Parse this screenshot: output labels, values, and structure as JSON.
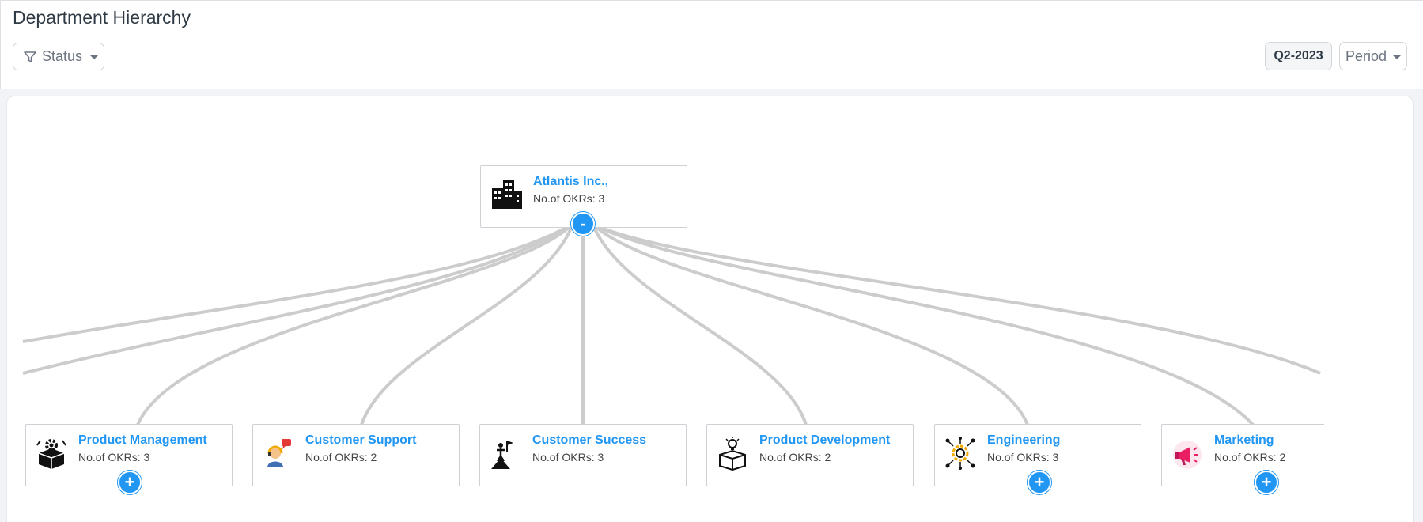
{
  "header": {
    "title": "Department Hierarchy",
    "filter_label": "Status",
    "period_value": "Q2-2023",
    "period_label": "Period"
  },
  "root": {
    "title": "Atlantis Inc.,",
    "okrs": "No.of OKRs: 3",
    "icon": "office-building-icon",
    "toggle": "-"
  },
  "departments": [
    {
      "title": "Product Management",
      "okrs": "No.of OKRs: 3",
      "icon": "gear-box-icon",
      "toggle": "+"
    },
    {
      "title": "Customer Support",
      "okrs": "No.of OKRs: 2",
      "icon": "support-agent-icon",
      "toggle": ""
    },
    {
      "title": "Customer Success",
      "okrs": "No.of OKRs: 3",
      "icon": "summit-flag-icon",
      "toggle": ""
    },
    {
      "title": "Product Development",
      "okrs": "No.of OKRs: 2",
      "icon": "idea-box-icon",
      "toggle": ""
    },
    {
      "title": "Engineering",
      "okrs": "No.of OKRs: 3",
      "icon": "network-gear-icon",
      "toggle": "+"
    },
    {
      "title": "Marketing",
      "okrs": "No.of OKRs: 2",
      "icon": "megaphone-icon",
      "toggle": "+"
    }
  ],
  "colors": {
    "accent": "#2196f3",
    "connector": "#cccccc",
    "title_text": "#2f3a45"
  }
}
